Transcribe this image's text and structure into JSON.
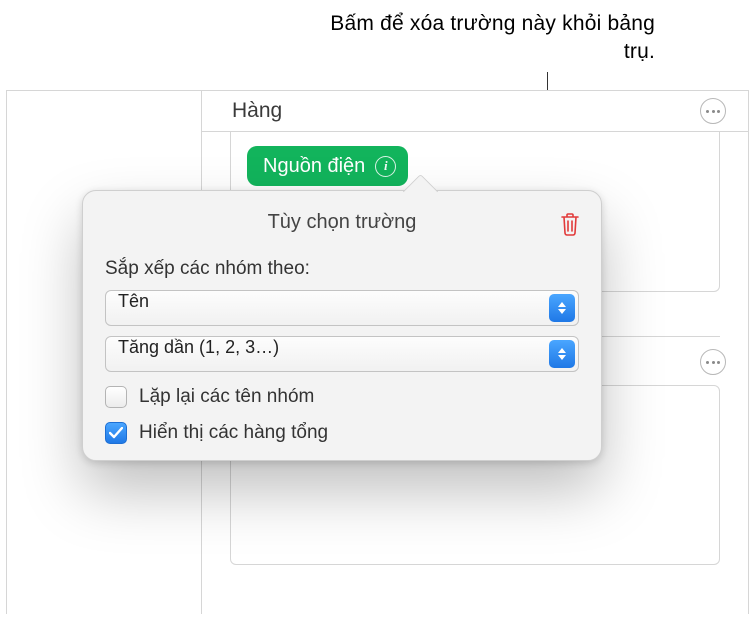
{
  "annotation": {
    "text": "Bấm để xóa trường này khỏi bảng trụ."
  },
  "section": {
    "row_label": "Hàng"
  },
  "chip": {
    "label": "Nguồn điện"
  },
  "popover": {
    "title": "Tùy chọn trường",
    "sort_groups_label": "Sắp xếp các nhóm theo:",
    "select1": "Tên",
    "select2": "Tăng dần (1, 2, 3…)",
    "checkbox1_label": "Lặp lại các tên nhóm",
    "checkbox1_checked": false,
    "checkbox2_label": "Hiển thị các hàng tổng",
    "checkbox2_checked": true
  }
}
